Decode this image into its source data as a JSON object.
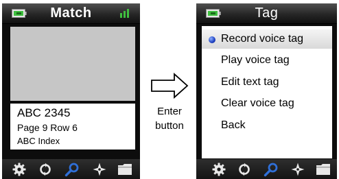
{
  "left_screen": {
    "title": "Match",
    "info": {
      "line1": "ABC 2345",
      "line2": "Page 9 Row  6",
      "line3": "ABC Index"
    }
  },
  "right_screen": {
    "title": "Tag",
    "menu": [
      {
        "label": "Record voice tag",
        "selected": true
      },
      {
        "label": "Play voice tag",
        "selected": false
      },
      {
        "label": "Edit text tag",
        "selected": false
      },
      {
        "label": "Clear voice tag",
        "selected": false
      },
      {
        "label": "Back",
        "selected": false
      }
    ]
  },
  "toolbar_icons": [
    "gear-icon",
    "rotate-icon",
    "search-icon",
    "compass-icon",
    "folder-icon"
  ],
  "caption": {
    "line1": "Enter",
    "line2": "button"
  },
  "colors": {
    "screen_bg": "#0d0d0d",
    "accent_blue": "#2f6fd8",
    "battery_green": "#3fbf3f"
  }
}
